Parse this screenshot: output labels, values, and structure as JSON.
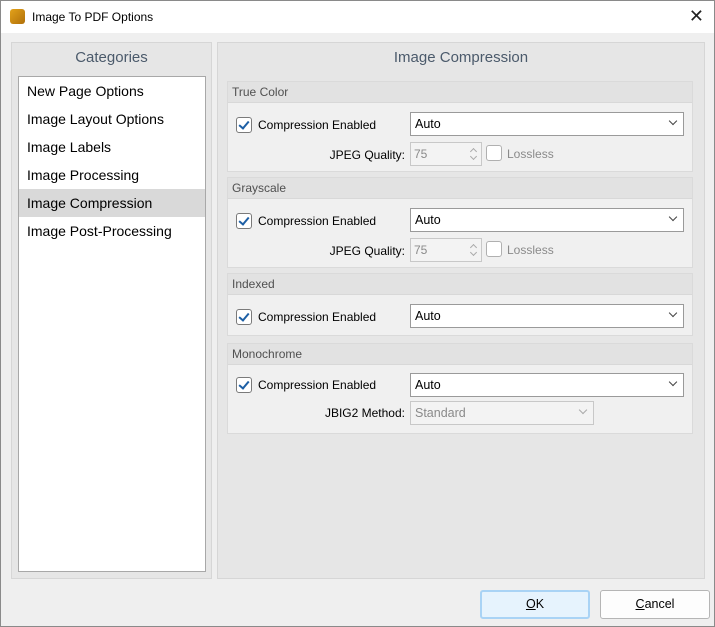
{
  "window": {
    "title": "Image To PDF Options",
    "close": "✕"
  },
  "categories": {
    "header": "Categories",
    "items": [
      "New Page Options",
      "Image Layout Options",
      "Image Labels",
      "Image Processing",
      "Image Compression",
      "Image Post-Processing"
    ],
    "selected": "Image Compression"
  },
  "main": {
    "header": "Image Compression",
    "groups": [
      {
        "title": "True Color",
        "compression_label": "Compression Enabled",
        "compression_checked": true,
        "method": "Auto",
        "quality_label": "JPEG Quality:",
        "quality": "75",
        "lossless_label": "Lossless"
      },
      {
        "title": "Grayscale",
        "compression_label": "Compression Enabled",
        "compression_checked": true,
        "method": "Auto",
        "quality_label": "JPEG Quality:",
        "quality": "75",
        "lossless_label": "Lossless"
      },
      {
        "title": "Indexed",
        "compression_label": "Compression Enabled",
        "compression_checked": true,
        "method": "Auto"
      },
      {
        "title": "Monochrome",
        "compression_label": "Compression Enabled",
        "compression_checked": true,
        "method": "Auto",
        "jbig2_label": "JBIG2 Method:",
        "jbig2": "Standard"
      }
    ]
  },
  "buttons": {
    "ok_u": "O",
    "ok_rest": "K",
    "cancel_u": "C",
    "cancel_rest": "ancel"
  }
}
